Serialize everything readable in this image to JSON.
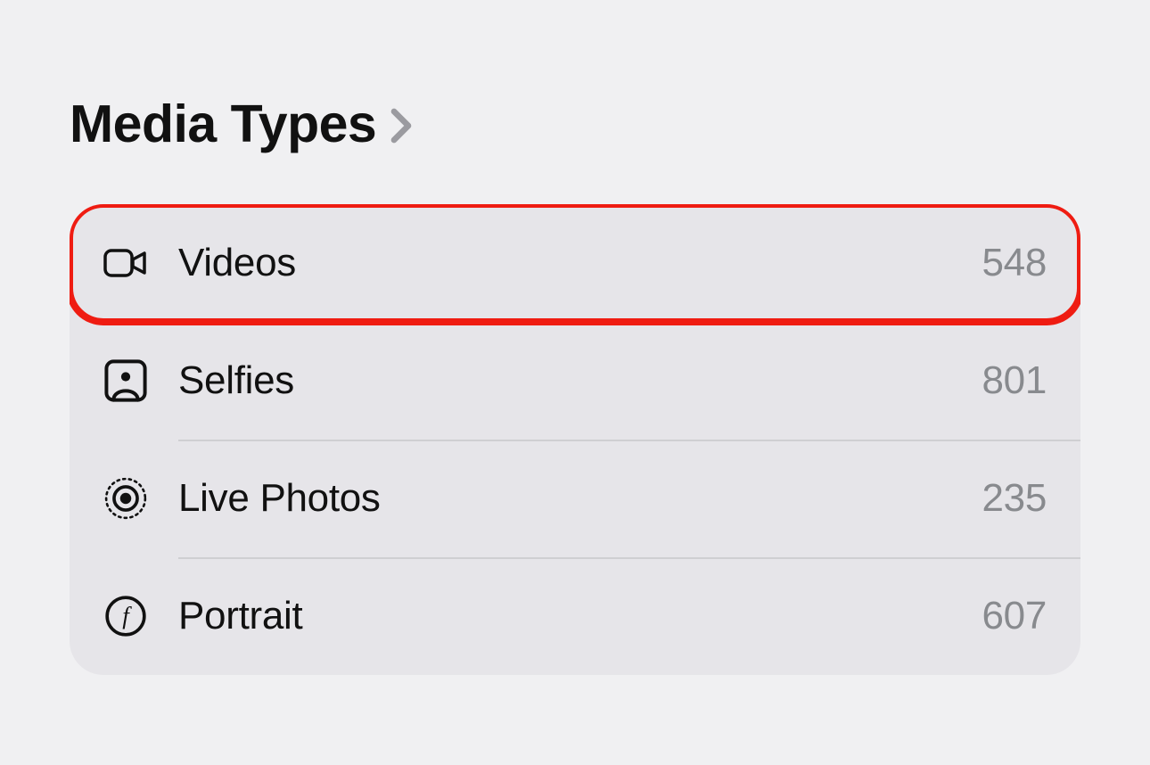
{
  "section": {
    "title": "Media Types",
    "items": [
      {
        "icon": "video-icon",
        "label": "Videos",
        "count": "548",
        "highlighted": true
      },
      {
        "icon": "selfie-icon",
        "label": "Selfies",
        "count": "801",
        "highlighted": false
      },
      {
        "icon": "live-photo-icon",
        "label": "Live Photos",
        "count": "235",
        "highlighted": false
      },
      {
        "icon": "portrait-icon",
        "label": "Portrait",
        "count": "607",
        "highlighted": false
      }
    ]
  },
  "colors": {
    "highlight_stroke": "#ef1c12",
    "background": "#f0f0f2",
    "list_background": "#e6e5e9",
    "text_primary": "#111111",
    "text_secondary": "#888a8e"
  }
}
